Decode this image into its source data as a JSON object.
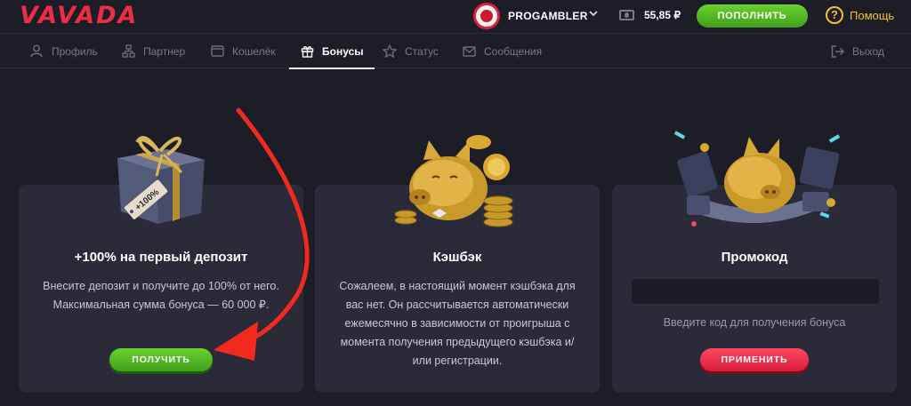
{
  "header": {
    "logo": "VAVADA",
    "username": "PROGAMBLER",
    "balance": "55,85 ₽",
    "deposit_label": "ПОПОЛНИТЬ",
    "help_label": "Помощь",
    "icons": [
      "avatar",
      "chevron-down-icon",
      "wallet-icon",
      "question-icon"
    ]
  },
  "nav": {
    "items": [
      {
        "label": "Профиль",
        "icon": "user-icon"
      },
      {
        "label": "Партнер",
        "icon": "network-icon"
      },
      {
        "label": "Кошелёк",
        "icon": "wallet-icon"
      },
      {
        "label": "Бонусы",
        "icon": "gift-icon",
        "active": true
      },
      {
        "label": "Статус",
        "icon": "star-icon"
      },
      {
        "label": "Сообщения",
        "icon": "envelope-icon"
      }
    ],
    "logout_label": "Выход"
  },
  "cards": {
    "deposit": {
      "title": "+100% на первый депозит",
      "text": "Внесите депозит и получите до 100% от него. Максимальная сумма бонуса — 60 000 ₽.",
      "button": "ПОЛУЧИТЬ",
      "gift_tag": "+100%"
    },
    "cashback": {
      "title": "Кэшбэк",
      "text": "Сожалеем, в настоящий момент кэшбэка для вас нет. Он рассчитывается автоматически ежемесячно в зависимости от проигрыша с момента получения предыдущего кэшбэка и/или регистрации."
    },
    "promo": {
      "title": "Промокод",
      "input_value": "",
      "hint": "Введите код для получения бонуса",
      "button": "ПРИМЕНИТЬ"
    }
  },
  "colors": {
    "background": "#1d1d27",
    "card": "#2a2a39",
    "brand_red": "#ea2e48",
    "green": "#4fb824",
    "help_yellow": "#f3c22a",
    "annotation_arrow": "#f22a1d"
  }
}
